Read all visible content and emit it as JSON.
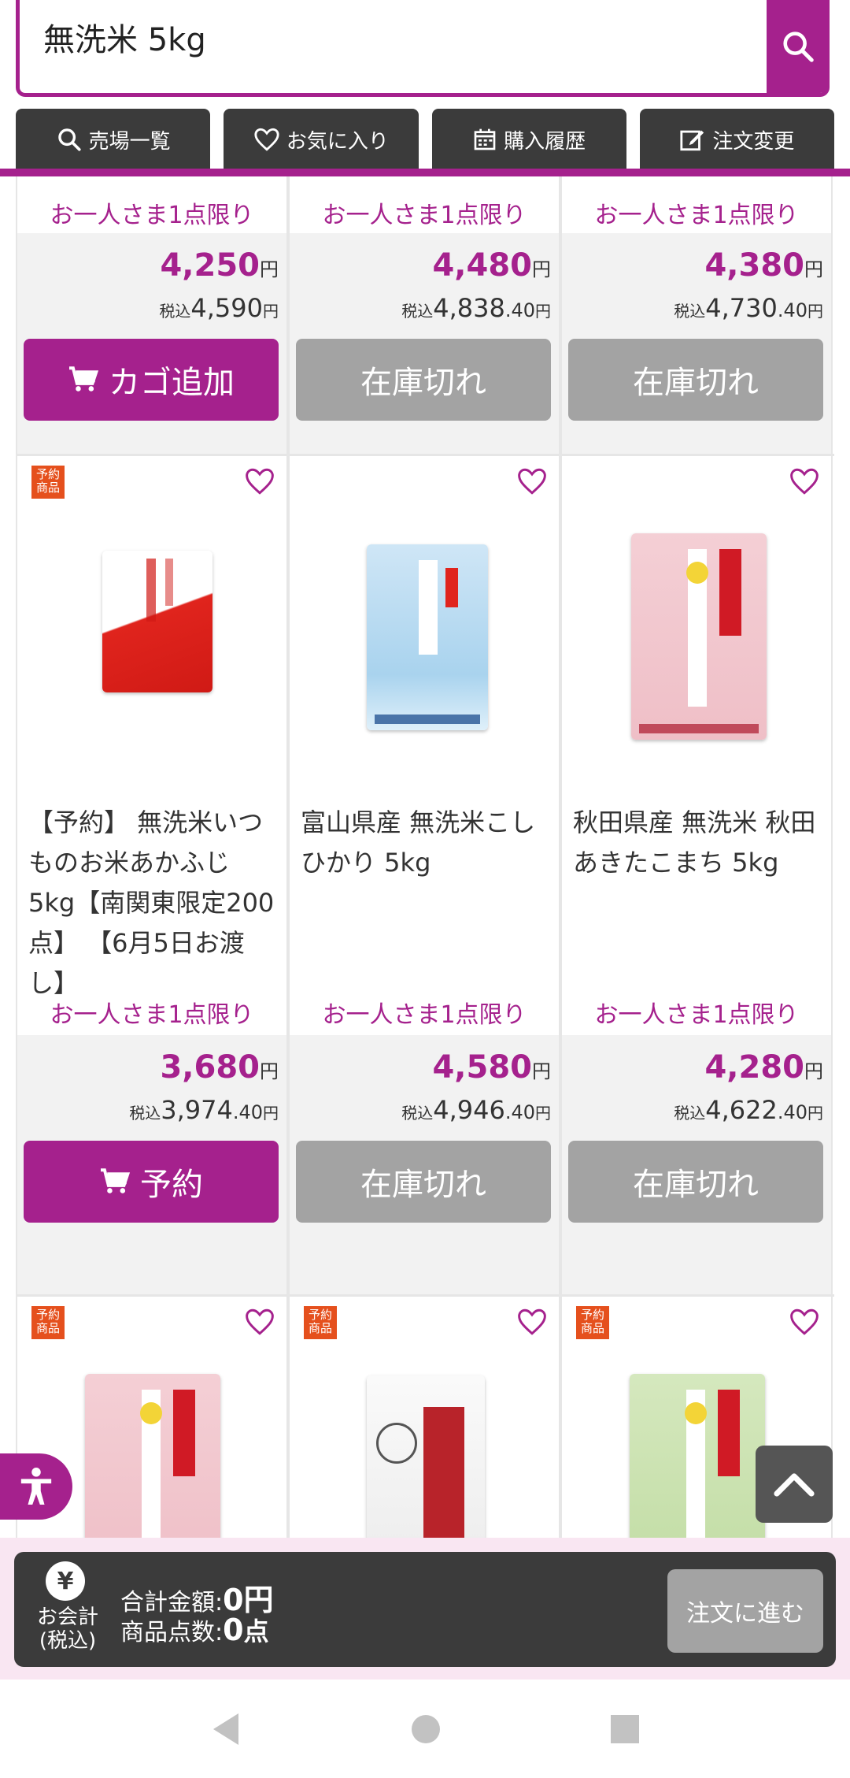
{
  "search": {
    "query": "無洗米 5kg"
  },
  "nav": {
    "tabs": [
      {
        "label": "売場一覧",
        "icon": "search-icon"
      },
      {
        "label": "お気に入り",
        "icon": "heart-outline-icon"
      },
      {
        "label": "購入履歴",
        "icon": "calendar-icon"
      },
      {
        "label": "注文変更",
        "icon": "edit-icon"
      }
    ]
  },
  "row1": [
    {
      "limit": "お一人さま1点限り",
      "price": "4,250",
      "yen": "円",
      "tax_prefix": "税込",
      "tax_main": "4,590",
      "tax_dec": "",
      "tax_yen": "円",
      "button": "カゴ追加",
      "button_state": "add"
    },
    {
      "limit": "お一人さま1点限り",
      "price": "4,480",
      "yen": "円",
      "tax_prefix": "税込",
      "tax_main": "4,838",
      "tax_dec": ".40",
      "tax_yen": "円",
      "button": "在庫切れ",
      "button_state": "out"
    },
    {
      "limit": "お一人さま1点限り",
      "price": "4,380",
      "yen": "円",
      "tax_prefix": "税込",
      "tax_main": "4,730",
      "tax_dec": ".40",
      "tax_yen": "円",
      "button": "在庫切れ",
      "button_state": "out"
    }
  ],
  "row2": [
    {
      "badge": "予約商品",
      "name": "【予約】 無洗米いつものお米あかふじ 5kg【南関東限定200点】 【6月5日お渡し】",
      "limit": "お一人さま1点限り",
      "price": "3,680",
      "yen": "円",
      "tax_prefix": "税込",
      "tax_main": "3,974",
      "tax_dec": ".40",
      "tax_yen": "円",
      "button": "予約",
      "button_state": "add"
    },
    {
      "badge": "",
      "name": "富山県産 無洗米こしひかり 5kg",
      "limit": "お一人さま1点限り",
      "price": "4,580",
      "yen": "円",
      "tax_prefix": "税込",
      "tax_main": "4,946",
      "tax_dec": ".40",
      "tax_yen": "円",
      "button": "在庫切れ",
      "button_state": "out"
    },
    {
      "badge": "",
      "name": "秋田県産 無洗米 秋田あきたこまち 5kg",
      "limit": "お一人さま1点限り",
      "price": "4,280",
      "yen": "円",
      "tax_prefix": "税込",
      "tax_main": "4,622",
      "tax_dec": ".40",
      "tax_yen": "円",
      "button": "在庫切れ",
      "button_state": "out"
    }
  ],
  "row3": [
    {
      "badge": "予約商品"
    },
    {
      "badge": "予約商品"
    },
    {
      "badge": "予約商品"
    }
  ],
  "checkout": {
    "yen_symbol": "¥",
    "label_line1": "お会計",
    "label_line2": "(税込)",
    "total_label": "合計金額:",
    "total_value": "0",
    "total_unit": "円",
    "count_label": "商品点数:",
    "count_value": "0",
    "count_unit": "点",
    "go_button": "注文に進む"
  },
  "colors": {
    "accent": "#a5218d",
    "disabled": "#a3a3a3",
    "dark": "#3b3b3b",
    "badge": "#e5501d"
  }
}
